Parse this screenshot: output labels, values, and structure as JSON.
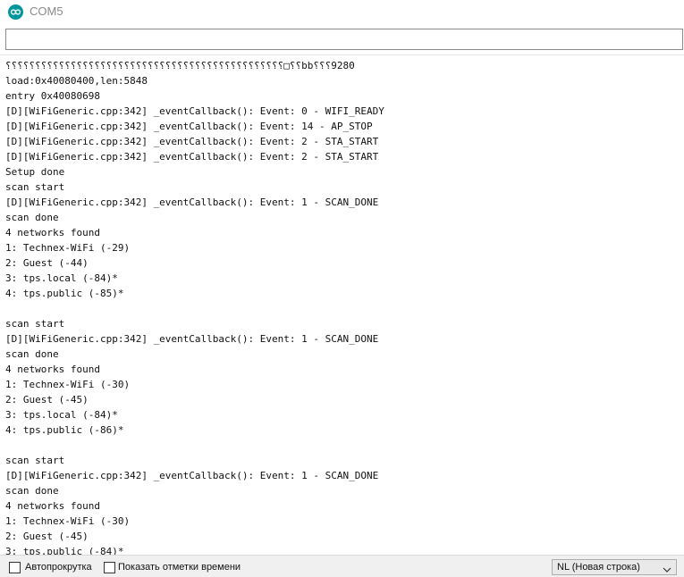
{
  "window": {
    "title": "COM5",
    "icon": "arduino-infinity-icon",
    "accent": "#00979c"
  },
  "send": {
    "value": "",
    "placeholder": ""
  },
  "console": {
    "lines": [
      "⸮⸮⸮⸮⸮⸮⸮⸮⸮⸮⸮⸮⸮⸮⸮⸮⸮⸮⸮⸮⸮⸮⸮⸮⸮⸮⸮⸮⸮⸮⸮⸮⸮⸮⸮⸮⸮⸮⸮⸮⸮⸮⸮⸮⸮⸮⸮□⸮⸮bb⸮⸮⸮9280",
      "load:0x40080400,len:5848",
      "entry 0x40080698",
      "[D][WiFiGeneric.cpp:342] _eventCallback(): Event: 0 - WIFI_READY",
      "[D][WiFiGeneric.cpp:342] _eventCallback(): Event: 14 - AP_STOP",
      "[D][WiFiGeneric.cpp:342] _eventCallback(): Event: 2 - STA_START",
      "[D][WiFiGeneric.cpp:342] _eventCallback(): Event: 2 - STA_START",
      "Setup done",
      "scan start",
      "[D][WiFiGeneric.cpp:342] _eventCallback(): Event: 1 - SCAN_DONE",
      "scan done",
      "4 networks found",
      "1: Technex-WiFi (-29)",
      "2: Guest (-44)",
      "3: tps.local (-84)*",
      "4: tps.public (-85)*",
      "",
      "scan start",
      "[D][WiFiGeneric.cpp:342] _eventCallback(): Event: 1 - SCAN_DONE",
      "scan done",
      "4 networks found",
      "1: Technex-WiFi (-30)",
      "2: Guest (-45)",
      "3: tps.local (-84)*",
      "4: tps.public (-86)*",
      "",
      "scan start",
      "[D][WiFiGeneric.cpp:342] _eventCallback(): Event: 1 - SCAN_DONE",
      "scan done",
      "4 networks found",
      "1: Technex-WiFi (-30)",
      "2: Guest (-45)",
      "3: tps.public (-84)*"
    ]
  },
  "statusbar": {
    "autoscroll_label": "Автопрокрутка",
    "autoscroll_checked": false,
    "timestamps_label": "Показать отметки времени",
    "timestamps_checked": false,
    "line_ending_selected": "NL (Новая строка)"
  }
}
